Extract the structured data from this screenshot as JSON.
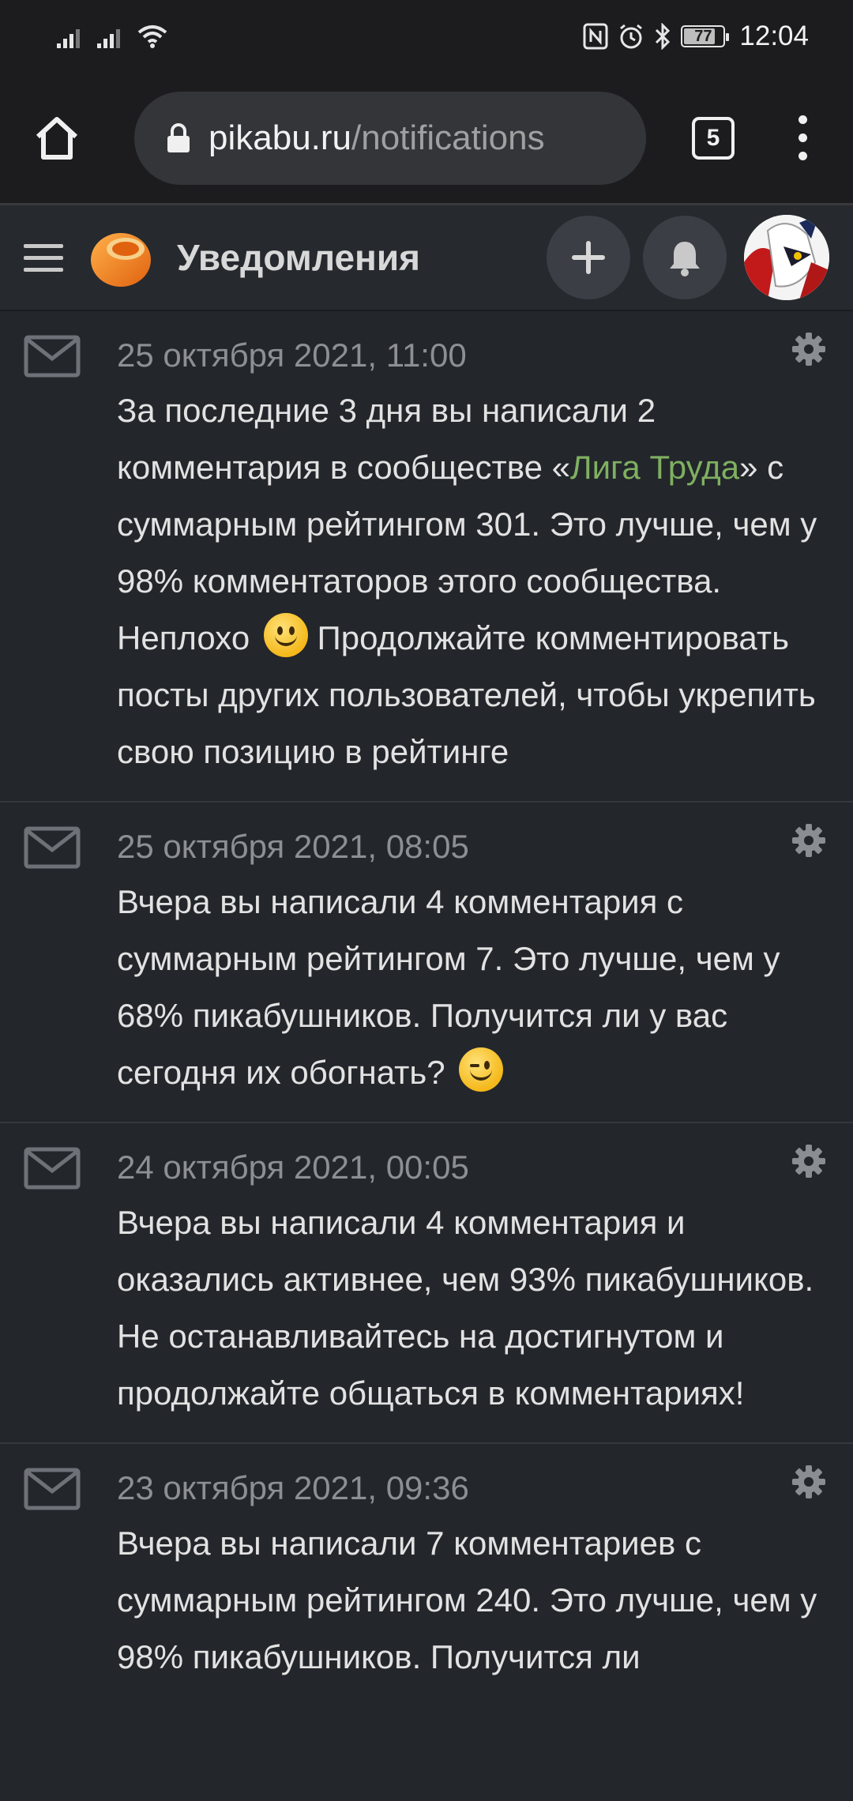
{
  "status_bar": {
    "battery": "77",
    "time": "12:04",
    "icons": [
      "signal-icon",
      "signal-icon",
      "wifi-icon",
      "nfc-icon",
      "alarm-icon",
      "bluetooth-icon",
      "battery-icon"
    ]
  },
  "browser": {
    "url_domain": "pikabu.ru",
    "url_path": "/notifications",
    "tab_count": "5"
  },
  "site_header": {
    "title": "Уведомления"
  },
  "notifications": [
    {
      "date": "25 октября 2021, 11:00",
      "text_before": "За последние 3 дня вы написали 2 комментария в сообществе «",
      "link": "Лига Труда",
      "text_after": "» с суммарным рейтингом 301. Это лучше, чем у 98% комментаторов этого сообщества. Неплохо",
      "text_end": "Продолжайте комментировать посты других пользователей, чтобы укрепить свою позицию в рейтинге",
      "emoji": "slightly-smiling-face"
    },
    {
      "date": "25 октября 2021, 08:05",
      "text": "Вчера вы написали 4 комментария с суммарным рейтингом 7. Это лучше, чем у 68% пикабушников. Получится ли у вас сегодня их обогнать?",
      "emoji": "winking-face"
    },
    {
      "date": "24 октября 2021, 00:05",
      "text": "Вчера вы написали 4 комментария и оказались активнее, чем 93% пикабушников. Не останавливайтесь на достигнутом и продолжайте общаться в комментариях!"
    },
    {
      "date": "23 октября 2021, 09:36",
      "text": "Вчера вы написали 7 комментариев с суммарным рейтингом 240. Это лучше, чем у 98% пикабушников. Получится ли"
    }
  ],
  "colors": {
    "background": "#23262b",
    "link": "#7fb061",
    "date": "#8c8f94",
    "logo_orange": "#f07a1a"
  }
}
